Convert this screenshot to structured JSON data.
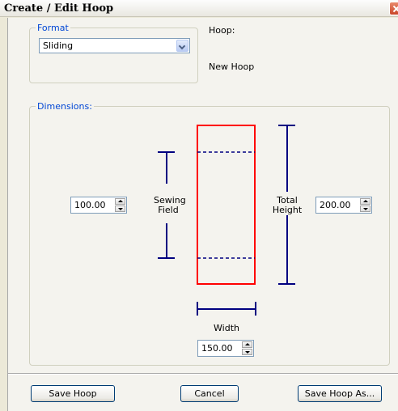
{
  "window": {
    "title": "Create / Edit Hoop"
  },
  "format_group": {
    "legend": "Format",
    "selected": "Sliding"
  },
  "hoop": {
    "label": "Hoop:",
    "name": "New Hoop"
  },
  "dimensions_group": {
    "legend": "Dimensions:",
    "sewing_field": {
      "label_line1": "Sewing",
      "label_line2": "Field",
      "value": "100.00"
    },
    "total_height": {
      "label_line1": "Total",
      "label_line2": "Height",
      "value": "200.00"
    },
    "width": {
      "label": "Width",
      "value": "150.00"
    }
  },
  "buttons": {
    "save": "Save Hoop",
    "cancel": "Cancel",
    "save_as": "Save Hoop As..."
  },
  "colors": {
    "hoop_outline": "#ff0000",
    "dimension_lines": "#000080",
    "legend_text": "#0046d5"
  }
}
